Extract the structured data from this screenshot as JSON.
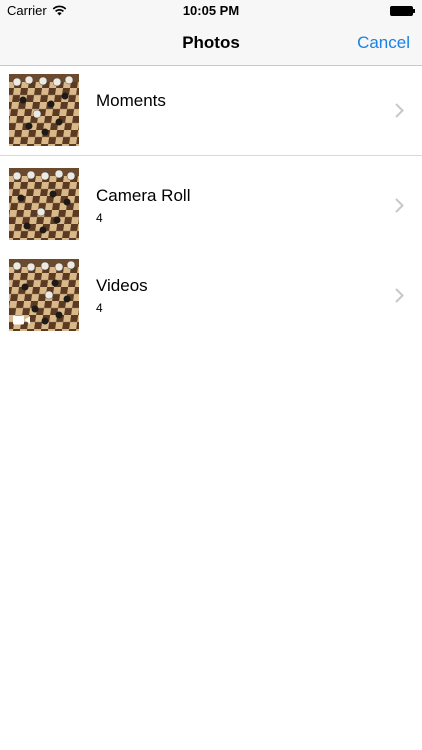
{
  "status_bar": {
    "carrier": "Carrier",
    "time": "10:05 PM",
    "icons": [
      "wifi-icon",
      "battery-icon"
    ]
  },
  "nav": {
    "title": "Photos",
    "cancel_label": "Cancel",
    "accent_color": "#1a82e2"
  },
  "albums": [
    {
      "name": "Moments",
      "count": "",
      "thumbnail": "chess-board-photo"
    },
    {
      "name": "Camera Roll",
      "count": "4",
      "thumbnail": "chess-board-photo"
    },
    {
      "name": "Videos",
      "count": "4",
      "thumbnail": "chess-board-photo",
      "badge": "video-camera-icon"
    }
  ]
}
